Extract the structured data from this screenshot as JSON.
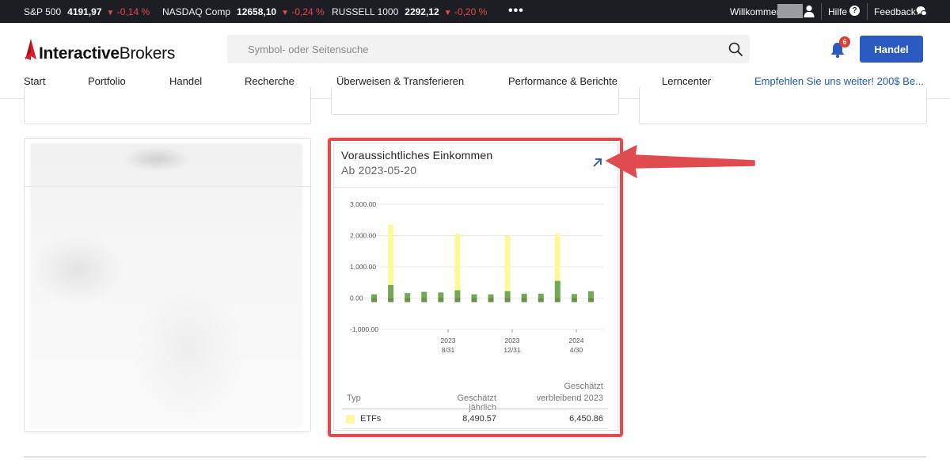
{
  "ticker": {
    "items": [
      {
        "name": "S&P 500",
        "value": "4191,97",
        "change": "-0,14 %"
      },
      {
        "name": "NASDAQ Comp",
        "value": "12658,10",
        "change": "-0,24 %"
      },
      {
        "name": "RUSSELL 1000",
        "value": "2292,12",
        "change": "-0,20 %"
      }
    ],
    "more": "•••",
    "welcome": "Willkommen",
    "help": "Hilfe",
    "help_icon_glyph": "?",
    "feedback": "Feedback"
  },
  "header": {
    "logo_part1": "Interactive",
    "logo_part2": "Brokers",
    "search_placeholder": "Symbol- oder Seitensuche",
    "notification_count": "6",
    "trade_button": "Handel"
  },
  "nav": {
    "items": [
      "Start",
      "Portfolio",
      "Handel",
      "Recherche",
      "Überweisen & Transferieren",
      "Performance & Berichte",
      "Lerncenter"
    ],
    "promo": "Empfehlen Sie uns weiter! 200$ Be..."
  },
  "income_card": {
    "title": "Voraussichtliches Einkommen",
    "subtitle": "Ab 2023-05-20",
    "table": {
      "headers": {
        "type": "Typ",
        "annual": "Geschätzt jährlich",
        "remaining_line1": "Geschätzt",
        "remaining_line2": "verbleibend 2023"
      },
      "rows": [
        {
          "type": "ETFs",
          "annual": "8,490.57",
          "remaining": "6,450.86"
        }
      ]
    }
  },
  "chart_data": {
    "type": "bar",
    "y_ticks": [
      "3,000.00",
      "2,000.00",
      "1,000.00",
      "0.00",
      "-1,000.00"
    ],
    "ylim": [
      -1000,
      3000
    ],
    "x_ticks": [
      {
        "year": "2023",
        "date": "8/31"
      },
      {
        "year": "2023",
        "date": "12/31"
      },
      {
        "year": "2024",
        "date": "4/30"
      }
    ],
    "series": [
      {
        "name": "ETFs",
        "color": "#fbf99a",
        "values": [
          0,
          2350,
          0,
          0,
          0,
          2050,
          0,
          0,
          2000,
          0,
          0,
          2050,
          0,
          0
        ]
      },
      {
        "color": "#74a857",
        "values": [
          120,
          420,
          160,
          200,
          180,
          250,
          120,
          120,
          220,
          140,
          140,
          550,
          130,
          220
        ]
      }
    ],
    "negative_values": [
      -130,
      -130,
      -130,
      -130,
      -130,
      -130,
      -130,
      -130,
      -130,
      -130,
      -130,
      -130,
      -130,
      -130
    ]
  },
  "colors": {
    "highlight": "#e04b4f",
    "primary": "#2b5bc2",
    "negative": "#e8474b"
  }
}
